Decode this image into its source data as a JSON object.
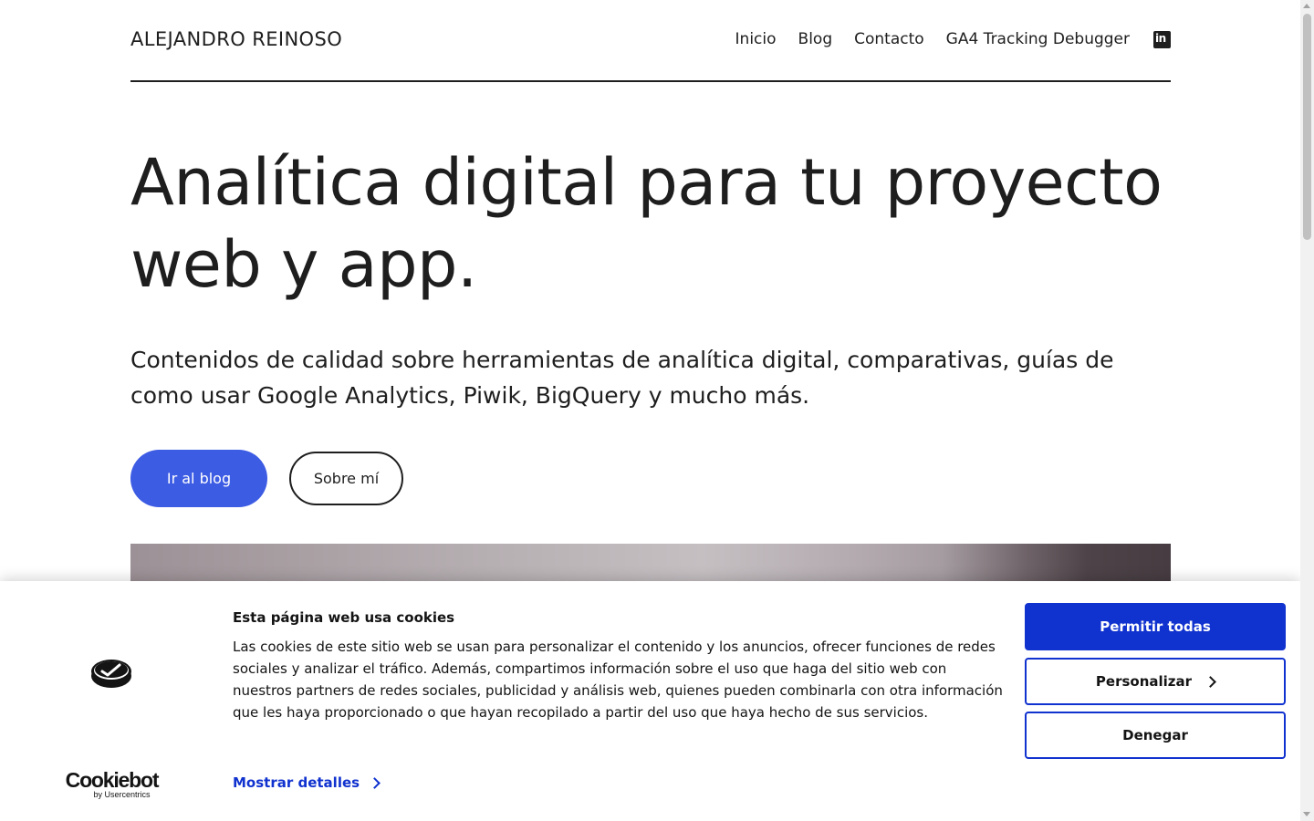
{
  "header": {
    "site_title": "ALEJANDRO REINOSO",
    "nav": [
      "Inicio",
      "Blog",
      "Contacto",
      "GA4 Tracking Debugger"
    ],
    "social_icon": "linkedin-icon"
  },
  "hero": {
    "title": "Analítica digital para tu proyecto web y app.",
    "subtitle": "Contenidos de calidad sobre herramientas de analítica digital, comparativas, guías de como usar Google Analytics, Piwik, BigQuery y mucho más.",
    "primary_button": "Ir al blog",
    "secondary_button": "Sobre mí"
  },
  "cookie_banner": {
    "title": "Esta página web usa cookies",
    "text": "Las cookies de este sitio web se usan para personalizar el contenido y los anuncios, ofrecer funciones de redes sociales y analizar el tráfico. Además, compartimos información sobre el uso que haga del sitio web con nuestros partners de redes sociales, publicidad y análisis web, quienes pueden combinarla con otra información que les haya proporcionado o que hayan recopilado a partir del uso que haya hecho de sus servicios.",
    "details_link": "Mostrar detalles",
    "allow_all": "Permitir todas",
    "customize": "Personalizar",
    "deny": "Denegar",
    "brand": "Cookiebot",
    "brand_by": "by Usercentrics"
  },
  "colors": {
    "accent": "#3d5ce4",
    "cookiebot_blue": "#1032cf",
    "text": "#1e1e1e"
  }
}
